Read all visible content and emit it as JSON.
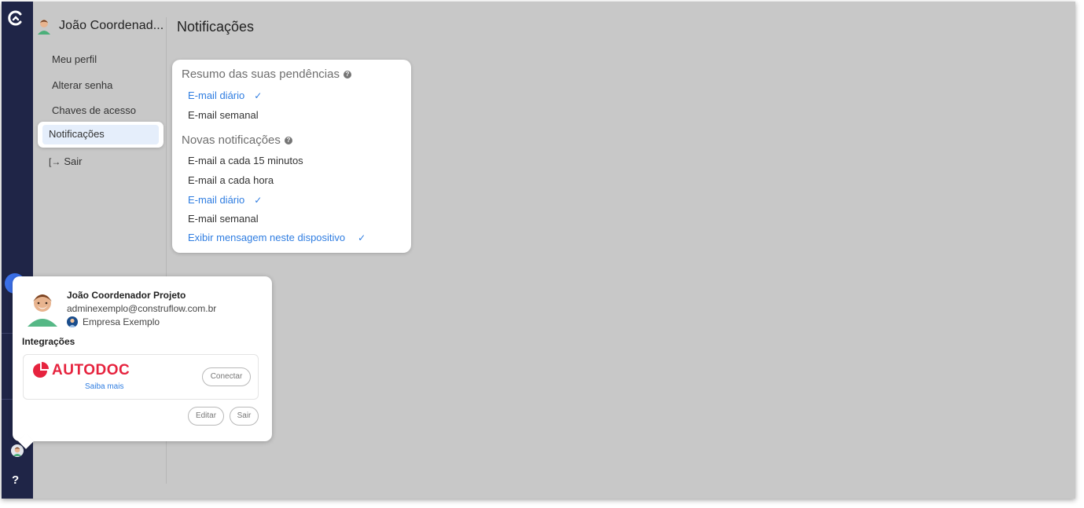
{
  "app": {
    "user_header_name": "João Coordenad...",
    "page_title": "Notificações"
  },
  "sidebar_menu": {
    "items": [
      {
        "label": "Meu perfil"
      },
      {
        "label": "Alterar senha"
      },
      {
        "label": "Chaves de acesso"
      },
      {
        "label": "Notificações",
        "active": true
      }
    ],
    "logout_icon": "logout-arrow-icon",
    "logout_label": "Sair"
  },
  "rail": {
    "help_label": "?"
  },
  "notifications": {
    "summary_title": "Resumo das suas pendências",
    "summary_options": [
      {
        "label": "E-mail diário",
        "selected": true
      },
      {
        "label": "E-mail semanal",
        "selected": false
      }
    ],
    "new_title": "Novas notificações",
    "new_options": [
      {
        "label": "E-mail a cada 15 minutos",
        "selected": false
      },
      {
        "label": "E-mail a cada hora",
        "selected": false
      },
      {
        "label": "E-mail diário",
        "selected": true
      },
      {
        "label": "E-mail semanal",
        "selected": false
      },
      {
        "label": "Exibir mensagem neste dispositivo",
        "selected": true
      }
    ],
    "check_glyph": "✓",
    "help_glyph": "?"
  },
  "user_card": {
    "name": "João Coordenador Projeto",
    "email": "adminexemplo@construflow.com.br",
    "company": "Empresa Exemplo",
    "integrations_title": "Integrações",
    "integration": {
      "brand": "AUTODOC",
      "link_label": "Saiba mais",
      "connect_label": "Conectar"
    },
    "edit_label": "Editar",
    "logout_label": "Sair"
  },
  "colors": {
    "rail": "#1f2547",
    "accent": "#2f7de1",
    "background": "#c8c8c8",
    "autodoc_red": "#e6233e"
  }
}
